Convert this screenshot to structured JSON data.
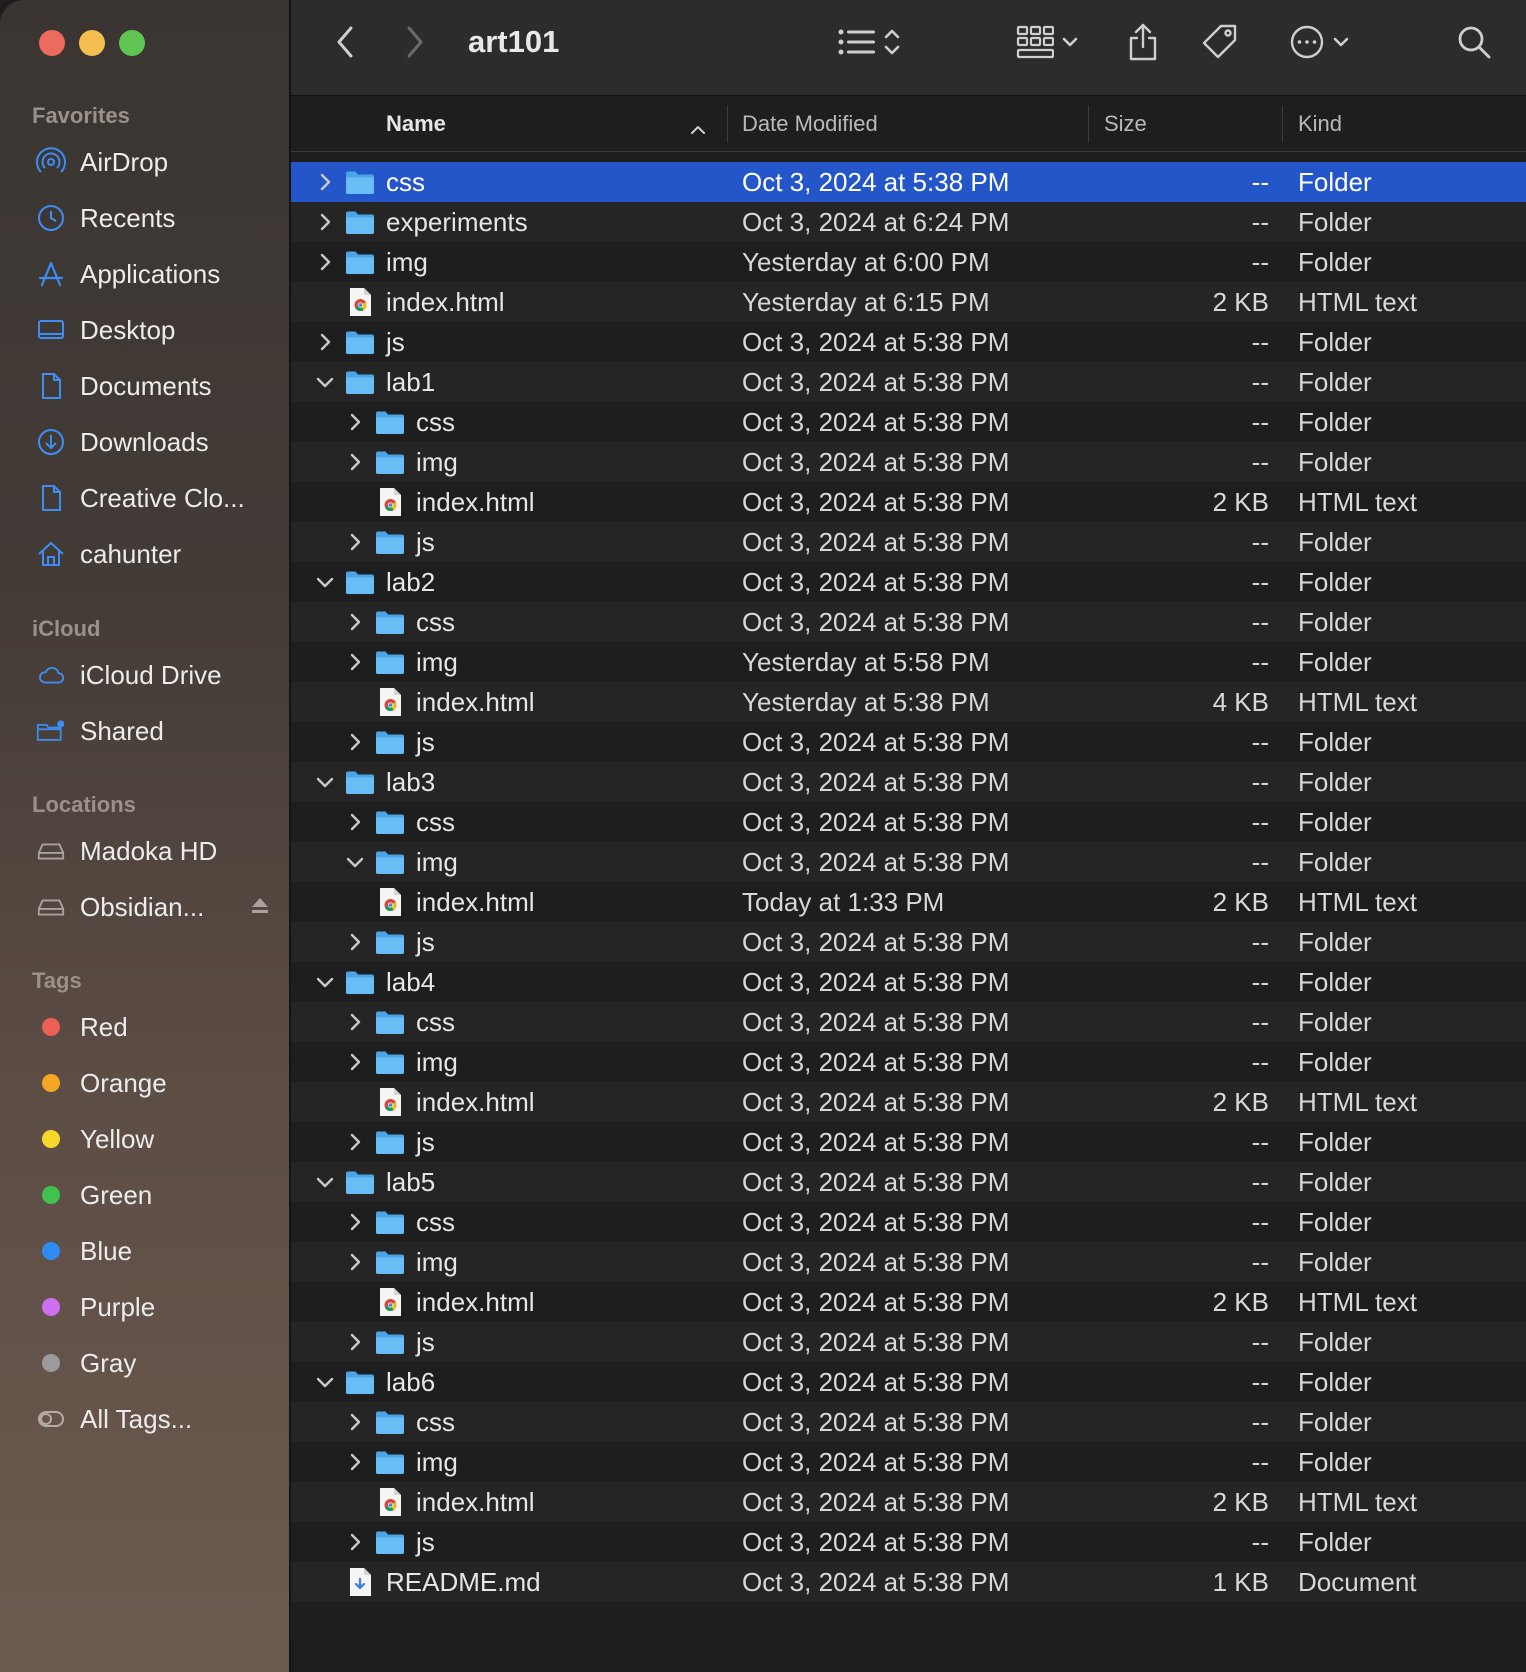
{
  "window": {
    "title": "art101"
  },
  "sidebar": {
    "favorites_label": "Favorites",
    "favorites": [
      {
        "label": "AirDrop",
        "icon": "airdrop-icon"
      },
      {
        "label": "Recents",
        "icon": "clock-icon"
      },
      {
        "label": "Applications",
        "icon": "applications-icon"
      },
      {
        "label": "Desktop",
        "icon": "desktop-icon"
      },
      {
        "label": "Documents",
        "icon": "document-icon"
      },
      {
        "label": "Downloads",
        "icon": "download-icon"
      },
      {
        "label": "Creative Clo...",
        "icon": "document-icon"
      },
      {
        "label": "cahunter",
        "icon": "home-icon"
      }
    ],
    "icloud_label": "iCloud",
    "icloud": [
      {
        "label": "iCloud Drive",
        "icon": "cloud-icon"
      },
      {
        "label": "Shared",
        "icon": "shared-folder-icon"
      }
    ],
    "locations_label": "Locations",
    "locations": [
      {
        "label": "Madoka HD",
        "icon": "disk-icon"
      },
      {
        "label": "Obsidian...",
        "icon": "disk-icon"
      }
    ],
    "tags_label": "Tags",
    "tags": [
      {
        "label": "Red",
        "color": "#ec5f57"
      },
      {
        "label": "Orange",
        "color": "#f5a623"
      },
      {
        "label": "Yellow",
        "color": "#f7d82a"
      },
      {
        "label": "Green",
        "color": "#3fc24e"
      },
      {
        "label": "Blue",
        "color": "#2f8cf2"
      },
      {
        "label": "Purple",
        "color": "#cf6ef0"
      },
      {
        "label": "Gray",
        "color": "#9b9b9d"
      },
      {
        "label": "All Tags...",
        "color": ""
      }
    ]
  },
  "columns": {
    "name": "Name",
    "date": "Date Modified",
    "size": "Size",
    "kind": "Kind"
  },
  "colors": {
    "selection": "#2456c9",
    "folder": "#5ab7f2"
  },
  "files": [
    {
      "name": "css",
      "date": "Oct 3, 2024 at 5:38 PM",
      "size": "--",
      "kind": "Folder",
      "type": "folder",
      "level": 0,
      "chevron": "right",
      "selected": true
    },
    {
      "name": "experiments",
      "date": "Oct 3, 2024 at 6:24 PM",
      "size": "--",
      "kind": "Folder",
      "type": "folder",
      "level": 0,
      "chevron": "right"
    },
    {
      "name": "img",
      "date": "Yesterday at 6:00 PM",
      "size": "--",
      "kind": "Folder",
      "type": "folder",
      "level": 0,
      "chevron": "right"
    },
    {
      "name": "index.html",
      "date": "Yesterday at 6:15 PM",
      "size": "2 KB",
      "kind": "HTML text",
      "type": "html",
      "level": 0,
      "chevron": "none"
    },
    {
      "name": "js",
      "date": "Oct 3, 2024 at 5:38 PM",
      "size": "--",
      "kind": "Folder",
      "type": "folder",
      "level": 0,
      "chevron": "right"
    },
    {
      "name": "lab1",
      "date": "Oct 3, 2024 at 5:38 PM",
      "size": "--",
      "kind": "Folder",
      "type": "folder",
      "level": 0,
      "chevron": "down"
    },
    {
      "name": "css",
      "date": "Oct 3, 2024 at 5:38 PM",
      "size": "--",
      "kind": "Folder",
      "type": "folder",
      "level": 1,
      "chevron": "right"
    },
    {
      "name": "img",
      "date": "Oct 3, 2024 at 5:38 PM",
      "size": "--",
      "kind": "Folder",
      "type": "folder",
      "level": 1,
      "chevron": "right"
    },
    {
      "name": "index.html",
      "date": "Oct 3, 2024 at 5:38 PM",
      "size": "2 KB",
      "kind": "HTML text",
      "type": "html",
      "level": 1,
      "chevron": "none"
    },
    {
      "name": "js",
      "date": "Oct 3, 2024 at 5:38 PM",
      "size": "--",
      "kind": "Folder",
      "type": "folder",
      "level": 1,
      "chevron": "right"
    },
    {
      "name": "lab2",
      "date": "Oct 3, 2024 at 5:38 PM",
      "size": "--",
      "kind": "Folder",
      "type": "folder",
      "level": 0,
      "chevron": "down"
    },
    {
      "name": "css",
      "date": "Oct 3, 2024 at 5:38 PM",
      "size": "--",
      "kind": "Folder",
      "type": "folder",
      "level": 1,
      "chevron": "right"
    },
    {
      "name": "img",
      "date": "Yesterday at 5:58 PM",
      "size": "--",
      "kind": "Folder",
      "type": "folder",
      "level": 1,
      "chevron": "right"
    },
    {
      "name": "index.html",
      "date": "Yesterday at 5:38 PM",
      "size": "4 KB",
      "kind": "HTML text",
      "type": "html",
      "level": 1,
      "chevron": "none"
    },
    {
      "name": "js",
      "date": "Oct 3, 2024 at 5:38 PM",
      "size": "--",
      "kind": "Folder",
      "type": "folder",
      "level": 1,
      "chevron": "right"
    },
    {
      "name": "lab3",
      "date": "Oct 3, 2024 at 5:38 PM",
      "size": "--",
      "kind": "Folder",
      "type": "folder",
      "level": 0,
      "chevron": "down"
    },
    {
      "name": "css",
      "date": "Oct 3, 2024 at 5:38 PM",
      "size": "--",
      "kind": "Folder",
      "type": "folder",
      "level": 1,
      "chevron": "right"
    },
    {
      "name": "img",
      "date": "Oct 3, 2024 at 5:38 PM",
      "size": "--",
      "kind": "Folder",
      "type": "folder",
      "level": 1,
      "chevron": "down"
    },
    {
      "name": "index.html",
      "date": "Today at 1:33 PM",
      "size": "2 KB",
      "kind": "HTML text",
      "type": "html",
      "level": 1,
      "chevron": "none"
    },
    {
      "name": "js",
      "date": "Oct 3, 2024 at 5:38 PM",
      "size": "--",
      "kind": "Folder",
      "type": "folder",
      "level": 1,
      "chevron": "right"
    },
    {
      "name": "lab4",
      "date": "Oct 3, 2024 at 5:38 PM",
      "size": "--",
      "kind": "Folder",
      "type": "folder",
      "level": 0,
      "chevron": "down"
    },
    {
      "name": "css",
      "date": "Oct 3, 2024 at 5:38 PM",
      "size": "--",
      "kind": "Folder",
      "type": "folder",
      "level": 1,
      "chevron": "right"
    },
    {
      "name": "img",
      "date": "Oct 3, 2024 at 5:38 PM",
      "size": "--",
      "kind": "Folder",
      "type": "folder",
      "level": 1,
      "chevron": "right"
    },
    {
      "name": "index.html",
      "date": "Oct 3, 2024 at 5:38 PM",
      "size": "2 KB",
      "kind": "HTML text",
      "type": "html",
      "level": 1,
      "chevron": "none"
    },
    {
      "name": "js",
      "date": "Oct 3, 2024 at 5:38 PM",
      "size": "--",
      "kind": "Folder",
      "type": "folder",
      "level": 1,
      "chevron": "right"
    },
    {
      "name": "lab5",
      "date": "Oct 3, 2024 at 5:38 PM",
      "size": "--",
      "kind": "Folder",
      "type": "folder",
      "level": 0,
      "chevron": "down"
    },
    {
      "name": "css",
      "date": "Oct 3, 2024 at 5:38 PM",
      "size": "--",
      "kind": "Folder",
      "type": "folder",
      "level": 1,
      "chevron": "right"
    },
    {
      "name": "img",
      "date": "Oct 3, 2024 at 5:38 PM",
      "size": "--",
      "kind": "Folder",
      "type": "folder",
      "level": 1,
      "chevron": "right"
    },
    {
      "name": "index.html",
      "date": "Oct 3, 2024 at 5:38 PM",
      "size": "2 KB",
      "kind": "HTML text",
      "type": "html",
      "level": 1,
      "chevron": "none"
    },
    {
      "name": "js",
      "date": "Oct 3, 2024 at 5:38 PM",
      "size": "--",
      "kind": "Folder",
      "type": "folder",
      "level": 1,
      "chevron": "right"
    },
    {
      "name": "lab6",
      "date": "Oct 3, 2024 at 5:38 PM",
      "size": "--",
      "kind": "Folder",
      "type": "folder",
      "level": 0,
      "chevron": "down"
    },
    {
      "name": "css",
      "date": "Oct 3, 2024 at 5:38 PM",
      "size": "--",
      "kind": "Folder",
      "type": "folder",
      "level": 1,
      "chevron": "right"
    },
    {
      "name": "img",
      "date": "Oct 3, 2024 at 5:38 PM",
      "size": "--",
      "kind": "Folder",
      "type": "folder",
      "level": 1,
      "chevron": "right"
    },
    {
      "name": "index.html",
      "date": "Oct 3, 2024 at 5:38 PM",
      "size": "2 KB",
      "kind": "HTML text",
      "type": "html",
      "level": 1,
      "chevron": "none"
    },
    {
      "name": "js",
      "date": "Oct 3, 2024 at 5:38 PM",
      "size": "--",
      "kind": "Folder",
      "type": "folder",
      "level": 1,
      "chevron": "right"
    },
    {
      "name": "README.md",
      "date": "Oct 3, 2024 at 5:38 PM",
      "size": "1 KB",
      "kind": "Document",
      "type": "doc",
      "level": 0,
      "chevron": "none"
    }
  ]
}
